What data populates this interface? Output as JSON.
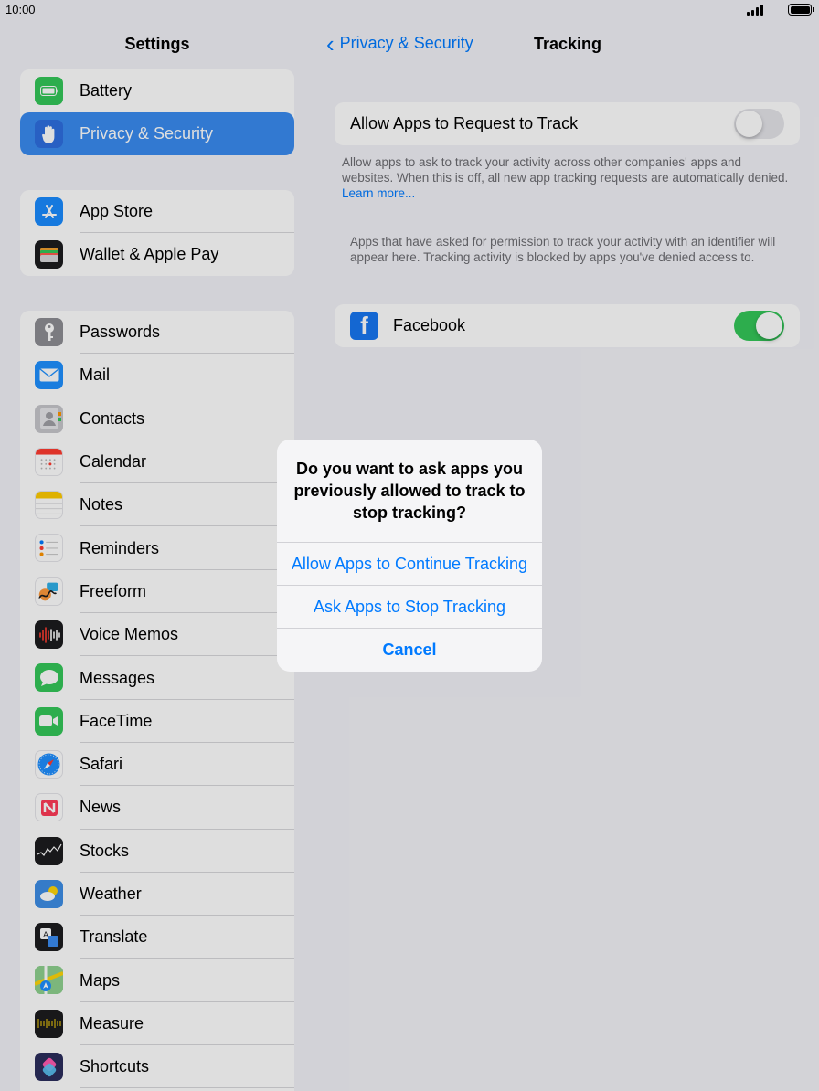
{
  "status_bar": {
    "time": "10:00"
  },
  "sidebar": {
    "title": "Settings",
    "group1": [
      {
        "label": "Battery",
        "icon": "battery-icon",
        "color": "#34c759",
        "selected": false
      },
      {
        "label": "Privacy & Security",
        "icon": "hand-icon",
        "color": "#2f7cf6",
        "selected": true
      }
    ],
    "group2": [
      {
        "label": "App Store",
        "icon": "app-store-icon",
        "color": "#1a8cff"
      },
      {
        "label": "Wallet & Apple Pay",
        "icon": "wallet-icon",
        "color": "#1c1c1e"
      }
    ],
    "group3": [
      {
        "label": "Passwords",
        "icon": "key-icon",
        "color": "#8e8e93"
      },
      {
        "label": "Mail",
        "icon": "mail-icon",
        "color": "#1e90ff"
      },
      {
        "label": "Contacts",
        "icon": "contacts-icon",
        "color": "#b8b8bd"
      },
      {
        "label": "Calendar",
        "icon": "calendar-icon",
        "color": "#ffffff"
      },
      {
        "label": "Notes",
        "icon": "notes-icon",
        "color": "#ffffff"
      },
      {
        "label": "Reminders",
        "icon": "reminders-icon",
        "color": "#ffffff"
      },
      {
        "label": "Freeform",
        "icon": "freeform-icon",
        "color": "#ffffff"
      },
      {
        "label": "Voice Memos",
        "icon": "voice-memos-icon",
        "color": "#1c1c1e"
      },
      {
        "label": "Messages",
        "icon": "messages-icon",
        "color": "#34c759"
      },
      {
        "label": "FaceTime",
        "icon": "facetime-icon",
        "color": "#34c759"
      },
      {
        "label": "Safari",
        "icon": "safari-icon",
        "color": "#ffffff"
      },
      {
        "label": "News",
        "icon": "news-icon",
        "color": "#ffffff"
      },
      {
        "label": "Stocks",
        "icon": "stocks-icon",
        "color": "#1c1c1e"
      },
      {
        "label": "Weather",
        "icon": "weather-icon",
        "color": "#3d8ee6"
      },
      {
        "label": "Translate",
        "icon": "translate-icon",
        "color": "#1c1c1e"
      },
      {
        "label": "Maps",
        "icon": "maps-icon",
        "color": "#7bc67b"
      },
      {
        "label": "Measure",
        "icon": "measure-icon",
        "color": "#1c1c1e"
      },
      {
        "label": "Shortcuts",
        "icon": "shortcuts-icon",
        "color": "#4b3bd6"
      }
    ]
  },
  "detail": {
    "back_label": "Privacy & Security",
    "title": "Tracking",
    "allow_request": {
      "label": "Allow Apps to Request to Track",
      "enabled": false
    },
    "allow_footnote": "Allow apps to ask to track your activity across other companies' apps and websites. When this is off, all new app tracking requests are automatically denied.",
    "learn_more": "Learn more...",
    "apps_footnote": "Apps that have asked for permission to track your activity with an identifier will appear here. Tracking activity is blocked by apps you've denied access to.",
    "apps": [
      {
        "label": "Facebook",
        "icon": "facebook-icon",
        "enabled": true
      }
    ]
  },
  "alert": {
    "title": "Do you want to ask apps you previously allowed to track to stop tracking?",
    "buttons": [
      {
        "label": "Allow Apps to Continue Tracking",
        "bold": false
      },
      {
        "label": "Ask Apps to Stop Tracking",
        "bold": false
      },
      {
        "label": "Cancel",
        "bold": true
      }
    ]
  },
  "colors": {
    "accent": "#007aff",
    "toggle_on": "#34c759",
    "selected_row": "#3a8cf0"
  }
}
